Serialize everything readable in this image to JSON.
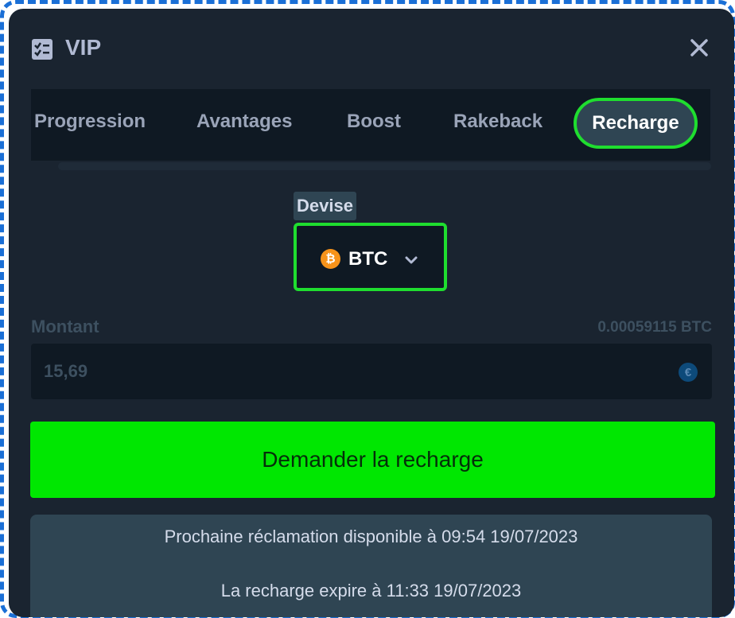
{
  "header": {
    "title": "VIP",
    "icon": "checklist-icon",
    "close_icon": "close-icon"
  },
  "tabs": [
    {
      "label": "Progression",
      "active": false
    },
    {
      "label": "Avantages",
      "active": false
    },
    {
      "label": "Boost",
      "active": false
    },
    {
      "label": "Rakeback",
      "active": false
    },
    {
      "label": "Recharge",
      "active": true
    }
  ],
  "currency": {
    "label": "Devise",
    "selected": "BTC",
    "icon": "bitcoin-icon",
    "icon_glyph": "₿"
  },
  "amount": {
    "label": "Montant",
    "crypto_equivalent": "0.00059115 BTC",
    "value": "15,69",
    "fiat_icon_glyph": "€"
  },
  "submit_button": {
    "label": "Demander la recharge"
  },
  "info": {
    "next_claim": "Prochaine réclamation disponible à 09:54 19/07/2023",
    "expires": "La recharge expire à 11:33 19/07/2023"
  },
  "colors": {
    "accent_green": "#00e701",
    "highlight_border": "#1fde2f",
    "modal_bg": "#1a2430",
    "panel_dark": "#0f1923",
    "btc_orange": "#f7931a"
  }
}
